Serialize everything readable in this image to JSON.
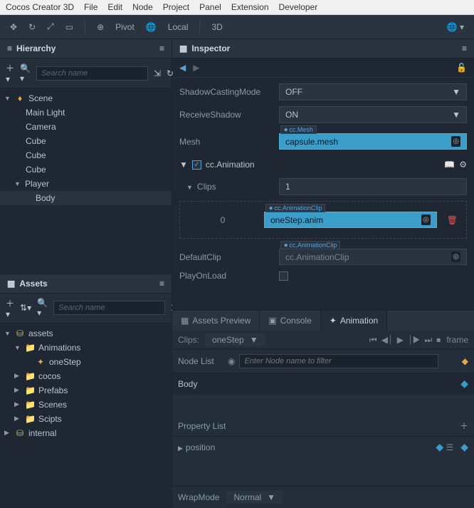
{
  "menubar": [
    "Cocos Creator 3D",
    "File",
    "Edit",
    "Node",
    "Project",
    "Panel",
    "Extension",
    "Developer"
  ],
  "toolbar": {
    "pivot": "Pivot",
    "local": "Local",
    "view": "3D"
  },
  "hierarchy": {
    "title": "Hierarchy",
    "search_placeholder": "Search name",
    "tree": [
      {
        "label": "Scene",
        "expanded": true,
        "icon": "fire"
      },
      {
        "label": "Main Light",
        "indent": 2
      },
      {
        "label": "Camera",
        "indent": 2
      },
      {
        "label": "Cube",
        "indent": 2
      },
      {
        "label": "Cube",
        "indent": 2
      },
      {
        "label": "Cube",
        "indent": 2
      },
      {
        "label": "Player",
        "expanded": true,
        "indent": 2,
        "arrow": true
      },
      {
        "label": "Body",
        "indent": 3,
        "selected": true
      }
    ]
  },
  "assets": {
    "title": "Assets",
    "search_placeholder": "Search name",
    "tree": [
      {
        "label": "assets",
        "expanded": true,
        "icon": "db",
        "color": "yellow"
      },
      {
        "label": "Animations",
        "expanded": true,
        "indent": 2,
        "icon": "folder"
      },
      {
        "label": "oneStep",
        "indent": 3,
        "icon": "anim",
        "color": "orange"
      },
      {
        "label": "cocos",
        "indent": 2,
        "icon": "folder",
        "arrow": true
      },
      {
        "label": "Prefabs",
        "indent": 2,
        "icon": "folder",
        "arrow": true
      },
      {
        "label": "Scenes",
        "indent": 2,
        "icon": "folder",
        "arrow": true
      },
      {
        "label": "Scipts",
        "indent": 2,
        "icon": "folder",
        "arrow": true
      },
      {
        "label": "internal",
        "icon": "db",
        "color": "yellow",
        "arrow": true,
        "indent": 1
      }
    ]
  },
  "inspector": {
    "title": "Inspector",
    "props": {
      "shadowCasting": {
        "label": "ShadowCastingMode",
        "value": "OFF"
      },
      "receiveShadow": {
        "label": "ReceiveShadow",
        "value": "ON"
      },
      "mesh": {
        "label": "Mesh",
        "tag": "cc.Mesh",
        "value": "capsule.mesh"
      }
    },
    "component": {
      "name": "cc.Animation",
      "clips": {
        "label": "Clips",
        "count": "1"
      },
      "clip0": {
        "idx": "0",
        "tag": "cc.AnimationClip",
        "value": "oneStep.anim"
      },
      "defaultClip": {
        "label": "DefaultClip",
        "tag": "cc.AnimationClip",
        "value": "cc.AnimationClip"
      },
      "playOnLoad": {
        "label": "PlayOnLoad"
      }
    }
  },
  "tabs": {
    "preview": "Assets Preview",
    "console": "Console",
    "animation": "Animation"
  },
  "animation": {
    "clips_label": "Clips:",
    "clip_name": "oneStep",
    "frame_label": "frame",
    "nodelist_label": "Node List",
    "nodelist_placeholder": "Enter Node name to filter",
    "body_label": "Body",
    "proplist_label": "Property List",
    "position_label": "position",
    "wrapmode_label": "WrapMode",
    "wrapmode_value": "Normal"
  }
}
